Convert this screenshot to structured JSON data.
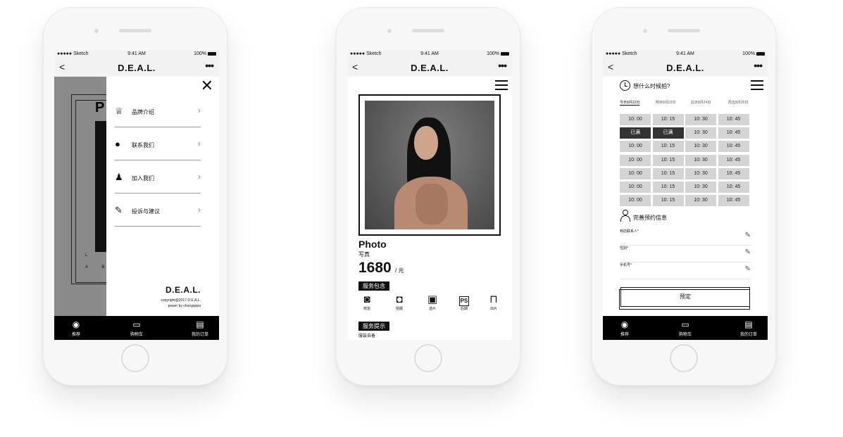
{
  "status": {
    "carrier": "●●●●● Sketch",
    "time": "9:41 AM",
    "battery": "100%"
  },
  "nav": {
    "back": "<",
    "title": "D.E.A.L.",
    "more": "•••"
  },
  "tabs": [
    {
      "label": "推荐",
      "icon": "record-icon"
    },
    {
      "label": "购物车",
      "icon": "cart-icon"
    },
    {
      "label": "我的订单",
      "icon": "orders-icon"
    }
  ],
  "screen1": {
    "close": "✕",
    "background_letter": "P",
    "background_text_1": "L",
    "background_text_2": "A B",
    "menu": [
      {
        "label": "品牌介绍",
        "icon": "crown-icon"
      },
      {
        "label": "联系我们",
        "icon": "chat-icon"
      },
      {
        "label": "加入我们",
        "icon": "add-user-icon"
      },
      {
        "label": "投诉与建议",
        "icon": "pen-icon"
      }
    ],
    "brand": "D.E.A.L.",
    "copyright": "copyright@2017 D.E.A.L.",
    "powered": "power by chongqopo"
  },
  "screen2": {
    "title": "Photo",
    "subtitle": "写真",
    "price": "1680",
    "unit": "/ 元",
    "service_include_label": "服务包含",
    "services": [
      {
        "label": "梳妆",
        "icon": "makeup-icon"
      },
      {
        "label": "拍摄",
        "icon": "camera-icon"
      },
      {
        "label": "选片",
        "icon": "gallery-icon"
      },
      {
        "label": "后期",
        "icon": "ps-icon"
      },
      {
        "label": "出片",
        "icon": "bag-icon"
      }
    ],
    "ps_text": "PS",
    "service_notice_label": "服务提示",
    "notice_text": "服装自备"
  },
  "screen3": {
    "question": "想什么时候拍?",
    "dates": [
      "今天8月22日",
      "明天8月23日",
      "后天8月24日",
      "周五8月25日"
    ],
    "slots": [
      [
        "10: 00",
        "10: 15",
        "10: 30",
        "10: 45"
      ],
      [
        "已满",
        "已满",
        "10: 30",
        "10: 45"
      ],
      [
        "10: 00",
        "10: 15",
        "10: 30",
        "10: 45"
      ],
      [
        "10: 00",
        "10: 15",
        "10: 30",
        "10: 45"
      ],
      [
        "10: 00",
        "10: 15",
        "10: 30",
        "10: 45"
      ],
      [
        "10: 00",
        "10: 15",
        "10: 30",
        "10: 45"
      ],
      [
        "10: 00",
        "10: 15",
        "10: 30",
        "10: 45"
      ]
    ],
    "full_label": "已满",
    "info_title": "完善预约信息",
    "fields": [
      "到店联系人*",
      "性别*",
      "手机号*"
    ],
    "confirm": "预定"
  }
}
